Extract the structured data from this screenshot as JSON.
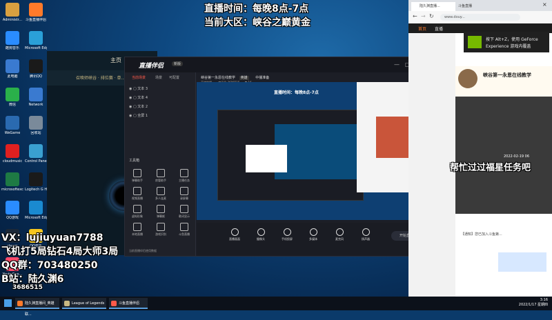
{
  "overlay": {
    "live_time": "直播时间：每晚8点-7点",
    "region": "当前大区：峡谷之巅黄金",
    "vx": "VX：lujiuyuan7788",
    "record": "飞机打5局钻石4局大师3局",
    "qq": "QQ群：703480250",
    "bili": "B站：陆久渊6",
    "room_id": "3686515"
  },
  "desktop_icons": [
    {
      "label": "Administr...",
      "color": "#d8a040"
    },
    {
      "label": "斗鱼直播伴侣",
      "color": "#ff7a2a"
    },
    {
      "label": "酷狗音乐",
      "color": "#2a8cff"
    },
    {
      "label": "Microsoft Edge",
      "color": "#2aa0d8"
    },
    {
      "label": "此电脑",
      "color": "#3a7ad0"
    },
    {
      "label": "腾讯QQ",
      "color": "#1a1a1a"
    },
    {
      "label": "微信",
      "color": "#2ab04a"
    },
    {
      "label": "Network",
      "color": "#3a7ad0"
    },
    {
      "label": "WeGame",
      "color": "#2a6ab0"
    },
    {
      "label": "回收站",
      "color": "#7a8a9a"
    },
    {
      "label": "cloudmusic",
      "color": "#e02020"
    },
    {
      "label": "Control Panel",
      "color": "#3aa0d0"
    },
    {
      "label": "microsoftexcel",
      "color": "#1e7a44"
    },
    {
      "label": "Logitech G HUB",
      "color": "#1a1a1a"
    },
    {
      "label": "QQ游戏",
      "color": "#2a8cff"
    },
    {
      "label": "Microsoft Edge",
      "color": "#1a8ad0"
    },
    {
      "label": "steam",
      "color": "#1b2838"
    },
    {
      "label": "QQ音乐",
      "color": "#f6c61e"
    },
    {
      "label": "YoukuDes...",
      "color": "#ff4a6a"
    }
  ],
  "lol_client": {
    "nav": "主页",
    "mode_label": "召唤师峡谷 · 排位赛 · 单..."
  },
  "obs": {
    "title": "直播伴侣",
    "version": "新版",
    "left_tabs": [
      "当前场景",
      "场景",
      "可配置"
    ],
    "sources": [
      "文本 3",
      "文本 4",
      "文本 2",
      "全屏 1"
    ],
    "tools_title": "工具箱",
    "tools": [
      "弹幕助手",
      "房管助手",
      "主播任务",
      "视频直播",
      "多人连麦",
      "录屏幕",
      "虚拟形象",
      "弹幕姬",
      "歌词显示",
      "本地直播",
      "游戏识别",
      "斗鱼直播"
    ],
    "room_title": "峡谷第一永恩在线教学",
    "room_tag": "英雄",
    "room_status": "中播准备",
    "room_sub": "英雄联盟",
    "room_id_label": "房间号",
    "room_id": "3686515",
    "fans": "16",
    "preview_text": "直播时间：每晚8点-7点",
    "controls": [
      "直播画面",
      "摄像头",
      "手机投屏",
      "多媒体",
      "麦克风",
      "扬声器"
    ],
    "go_live": "开始直播",
    "notice": "当前直播伴侣使用数据"
  },
  "browser": {
    "tabs": [
      "陆久渊直播...",
      "斗鱼直播"
    ],
    "url": "www.douy...",
    "site_nav": [
      "首页",
      "直播"
    ],
    "nvidia_line1": "按下 Alt+Z，使用 GeForce",
    "nvidia_line2": "Experience 游戏内覆盖",
    "streamer_title": "峡谷第一永恩在线教学",
    "date_text": "2022-02-19 06",
    "banner": "帮忙过过福星任务吧",
    "chat_notice": "【通知】您已加入斗鱼第..."
  },
  "taskbar": {
    "items": [
      "陆久渊直播间_英雄联...",
      "League of Legends",
      "斗鱼直播伴侣"
    ],
    "time": "3:16",
    "date": "2022/1/17 星期四"
  }
}
